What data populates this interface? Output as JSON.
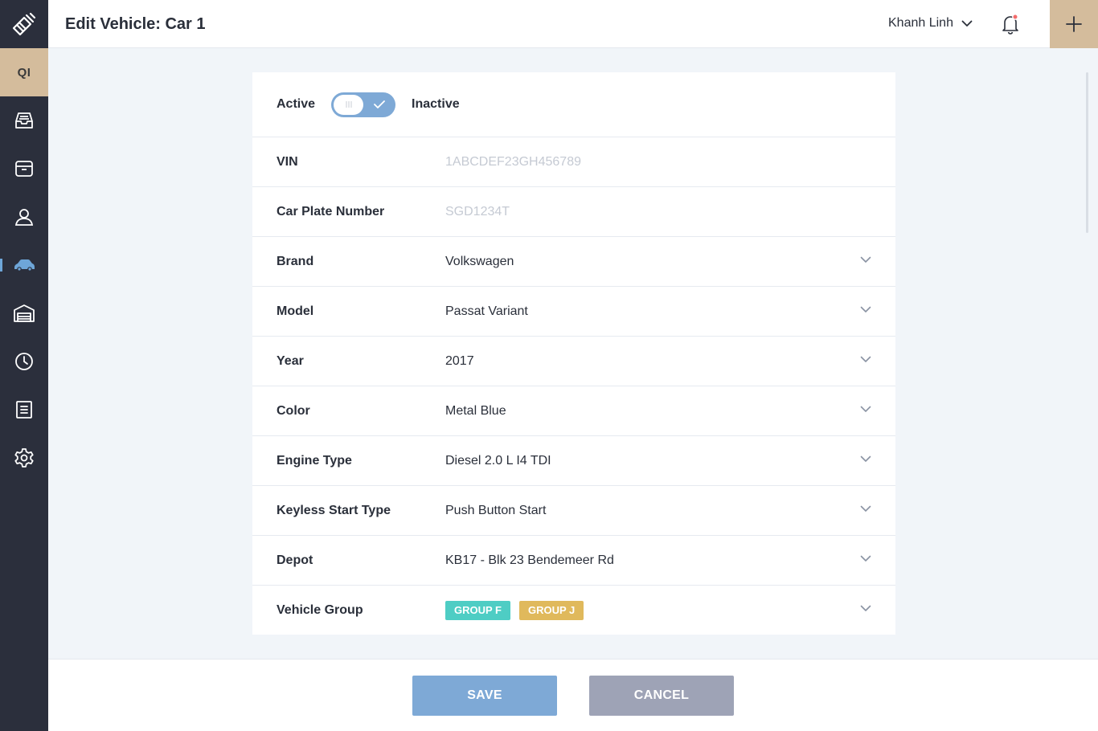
{
  "header": {
    "title": "Edit Vehicle: Car 1",
    "user_name": "Khanh Linh"
  },
  "sidebar": {
    "org_initials": "QI",
    "items": [
      {
        "name": "inbox"
      },
      {
        "name": "browser"
      },
      {
        "name": "users"
      },
      {
        "name": "vehicles",
        "active": true
      },
      {
        "name": "garage"
      },
      {
        "name": "history"
      },
      {
        "name": "reports"
      },
      {
        "name": "settings"
      }
    ]
  },
  "form": {
    "status": {
      "active_label": "Active",
      "inactive_label": "Inactive"
    },
    "fields": [
      {
        "label": "VIN",
        "placeholder": "1ABCDEF23GH456789"
      },
      {
        "label": "Car Plate Number",
        "placeholder": "SGD1234T"
      },
      {
        "label": "Brand",
        "value": "Volkswagen"
      },
      {
        "label": "Model",
        "value": "Passat Variant"
      },
      {
        "label": "Year",
        "value": "2017"
      },
      {
        "label": "Color",
        "value": "Metal Blue"
      },
      {
        "label": "Engine Type",
        "value": "Diesel 2.0 L I4 TDI"
      },
      {
        "label": "Keyless Start Type",
        "value": "Push Button Start"
      },
      {
        "label": "Depot",
        "value": "KB17 - Blk 23 Bendemeer Rd"
      }
    ],
    "vehicle_group": {
      "label": "Vehicle Group",
      "tags": [
        {
          "text": "GROUP F",
          "color": "#4ecdc4"
        },
        {
          "text": "GROUP J",
          "color": "#e0b95c"
        }
      ]
    }
  },
  "actions": {
    "save_label": "SAVE",
    "cancel_label": "CANCEL"
  },
  "colors": {
    "sidebar_bg": "#2b2f3c",
    "accent": "#d4bc9c",
    "primary": "#7ea9d6",
    "secondary": "#9ea3b6",
    "notification_dot": "#f36b6b"
  }
}
